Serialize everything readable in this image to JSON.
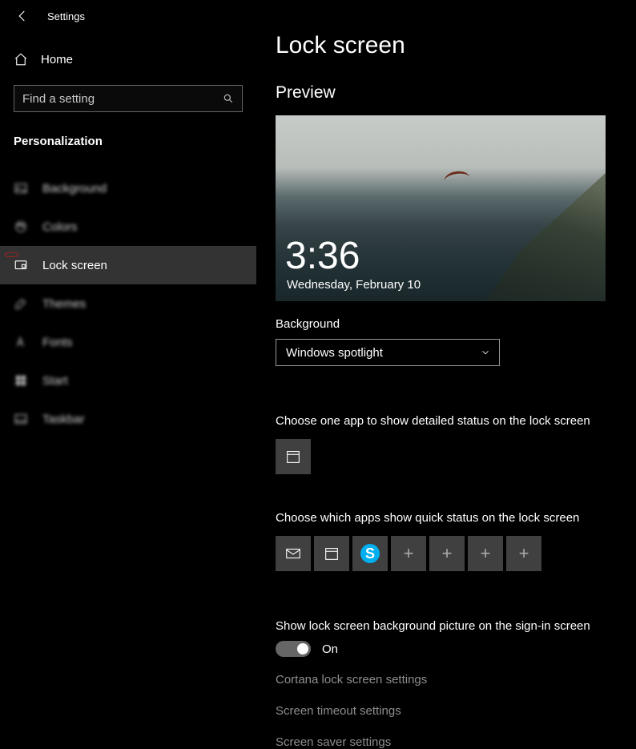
{
  "titlebar": {
    "title": "Settings"
  },
  "home": {
    "label": "Home"
  },
  "search": {
    "placeholder": "Find a setting"
  },
  "section": {
    "header": "Personalization"
  },
  "nav": {
    "background": "Background",
    "colors": "Colors",
    "lockscreen": "Lock screen",
    "themes": "Themes",
    "fonts": "Fonts",
    "start": "Start",
    "taskbar": "Taskbar"
  },
  "main": {
    "title": "Lock screen",
    "preview_label": "Preview",
    "preview_time": "3:36",
    "preview_date": "Wednesday, February 10",
    "background_label": "Background",
    "background_value": "Windows spotlight",
    "detailed_label": "Choose one app to show detailed status on the lock screen",
    "quick_label": "Choose which apps show quick status on the lock screen",
    "signin_label": "Show lock screen background picture on the sign-in screen",
    "toggle_state": "On",
    "link_cortana": "Cortana lock screen settings",
    "link_timeout": "Screen timeout settings",
    "link_saver": "Screen saver settings"
  },
  "icons": {
    "skype_letter": "S"
  }
}
